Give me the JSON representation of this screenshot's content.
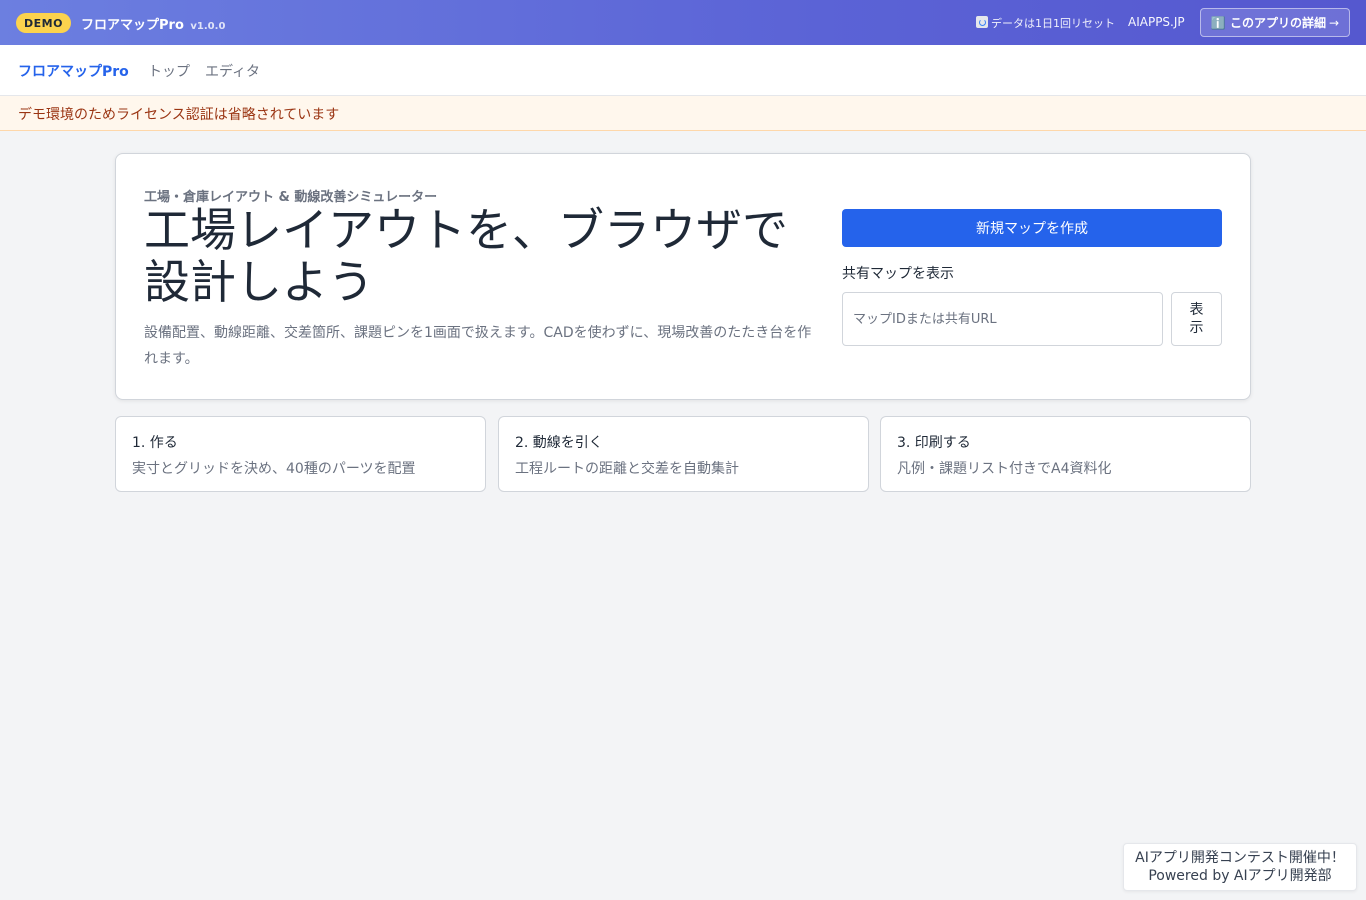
{
  "demo_bar": {
    "badge": "DEMO",
    "app_name": "フロアマップPro",
    "version": "v1.0.0",
    "reset_notice": "データは1日1回リセット",
    "site_link": "AIAPPS.JP",
    "detail_button": "ℹ️ このアプリの詳細",
    "detail_arrow": "→"
  },
  "nav": {
    "brand": "フロアマップPro",
    "links": [
      "トップ",
      "エディタ"
    ]
  },
  "notice": "デモ環境のためライセンス認証は省略されています",
  "hero": {
    "eyebrow": "工場・倉庫レイアウト & 動線改善シミュレーター",
    "title": "工場レイアウトを、ブラウザで設計しよう",
    "description": "設備配置、動線距離、交差箇所、課題ピンを1画面で扱えます。CADを使わずに、現場改善のたたき台を作れます。",
    "create_button": "新規マップを作成",
    "shared_label": "共有マップを表示",
    "shared_placeholder": "マップIDまたは共有URL",
    "view_button": "表示"
  },
  "steps": [
    {
      "title": "1. 作る",
      "desc": "実寸とグリッドを決め、40種のパーツを配置"
    },
    {
      "title": "2. 動線を引く",
      "desc": "工程ルートの距離と交差を自動集計"
    },
    {
      "title": "3. 印刷する",
      "desc": "凡例・課題リスト付きでA4資料化"
    }
  ],
  "contest": {
    "line1": "AIアプリ開発コンテスト開催中！",
    "line2": "Powered by AIアプリ開発部"
  }
}
